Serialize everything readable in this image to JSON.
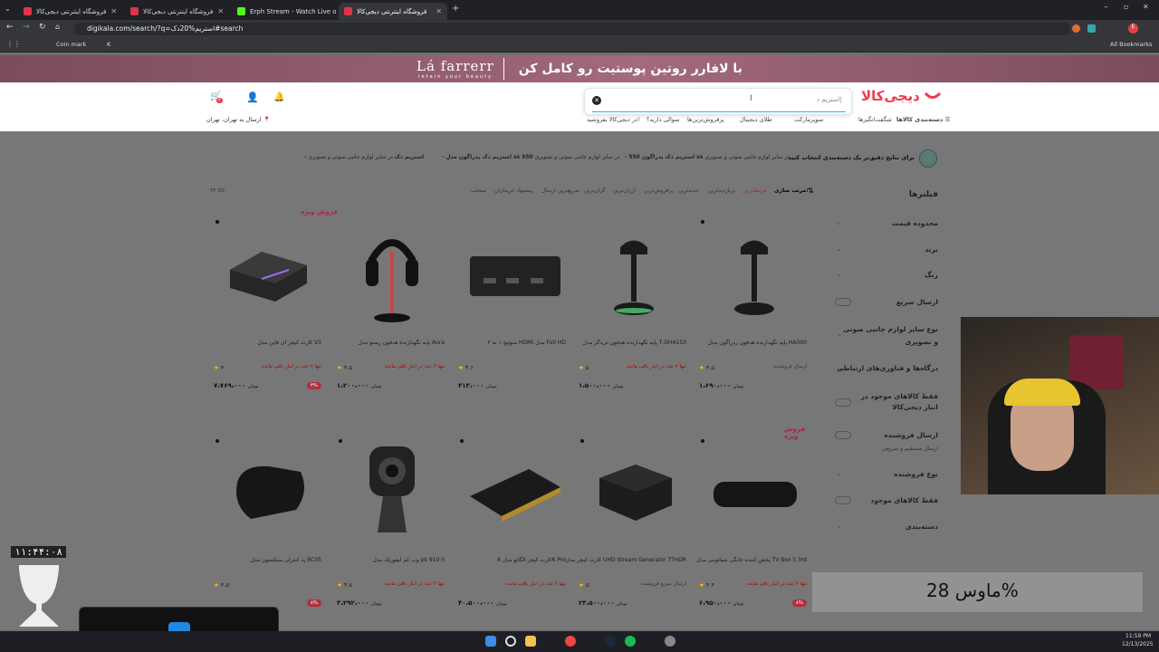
{
  "browser": {
    "tabs": [
      {
        "title": "فروشگاه اینترنتی دیجی‌کالا",
        "color": "#e0334a"
      },
      {
        "title": "فروشگاه اینترنتی دیجی‌کالا",
        "color": "#e0334a"
      },
      {
        "title": "Erph Stream - Watch Live on K",
        "color": "#53fc18"
      },
      {
        "title": "فروشگاه اینترنتی دیجی‌کالا",
        "color": "#e0334a"
      }
    ],
    "url": "digikala.com/search/?q=استریم%20دک#search",
    "bookmarks": [
      "Coin mark",
      "K"
    ],
    "all_bookmarks": "All Bookmarks"
  },
  "banner": {
    "text": "با لافارر روتین پوستیت رو کامل کن",
    "brand": "Lá farrerr",
    "tagline": "retain your beauty"
  },
  "header": {
    "logo": "دیجی‌کالا",
    "search_value": "استریم د|",
    "location": "ارسال به تهران، تهران",
    "cart_count": "۲"
  },
  "nav": {
    "categories": "دسته‌بندی کالاها",
    "items": [
      "شگفت‌انگیزها",
      "سوپرمارکت",
      "طلای دیجیتال",
      "پرفروش‌ترین‌ها",
      "سوالی دارید؟",
      "در دیجی‌کالا بفروشید!"
    ]
  },
  "suggest": {
    "lead": "برای نتایج دقیق‌تر یک دسته‌بندی انتخاب کنید",
    "chips": [
      {
        "bold": "استریم دک پدراگون 550 ss",
        "rest": "در سایر لوازم جانبی صوتی و تصویری"
      },
      {
        "bold": "استریم دک پدراگون مدل ss 550",
        "rest": "در سایر لوازم جانبی صوتی و تصویری"
      },
      {
        "bold": "استریم دک",
        "rest": "در سایر لوازم جانبی صوتی و تصویری"
      }
    ]
  },
  "sort": {
    "label": "مرتب سازی:",
    "options": [
      "مرتبط‌ترین",
      "پربازدیدترین",
      "جدیدترین",
      "پرفروش‌ترین",
      "ارزان‌ترین",
      "گران‌ترین",
      "سریع‌ترین ارسال",
      "پیشنهاد خریداران",
      "منتخب"
    ],
    "count": "۳۳ کالا"
  },
  "filters": {
    "title": "فیلترها",
    "items": [
      "محدوده قیمت",
      "برند",
      "رنگ",
      "ارسال سریع",
      "نوع سایر لوازم جانبی صوتی و تصویری",
      "درگاه‌ها و فناوری‌های ارتباطی",
      "فقط کالاهای موجود در انبار دیجی‌کالا",
      "ارسال فروشنده",
      "نوع فروشنده",
      "فقط کالاهای موجود",
      "دسته‌بندی"
    ],
    "seller_sub": "ارسال مستقیم و سریع‌تر"
  },
  "products": [
    {
      "title": "پایه نگهدارنده هدفون ردراگون مدل HA300",
      "rating": "۴.۵",
      "stock": "ارسال فروشنده",
      "price": "۱،۶۹۰،۰۰۰",
      "disc": "",
      "special": ""
    },
    {
      "title": "پایه نگهدارنده هدفون تی‌دگر مدل T-GHA153",
      "rating": "۵",
      "stock": "تنها ۲ عدد در انبار باقی مانده",
      "price": "۱،۵۰۰،۰۰۰",
      "disc": "",
      "special": ""
    },
    {
      "title": "سوئیچ ۱ به ۲ HDMI مدل Full HD",
      "rating": "۳.۶",
      "stock": "",
      "price": "۴۱۳،۰۰۰",
      "disc": "",
      "special": ""
    },
    {
      "title": "پایه نگهدارنده هدفون رسنو مدل Aura",
      "rating": "۴.۵",
      "stock": "تنها ۲ عدد در انبار باقی مانده",
      "price": "۱،۲۰۰،۰۰۰",
      "disc": "",
      "special": "فروش ویژه"
    },
    {
      "title": "کارت کپچر ای فاین مدل V3",
      "rating": "۴",
      "stock": "تنها ۲ عدد در انبار باقی مانده",
      "price": "۷،۷۶۹،۰۰۰",
      "disc": "۳%",
      "special": ""
    },
    {
      "title": "پخش کننده خانگی شیائومی مدل TV Box S 3rd",
      "rating": "۴.۴",
      "stock": "تنها ۲ عدد در انبار باقی مانده",
      "price": "۶،۹۵۰،۰۰۰",
      "disc": "۸%",
      "special": "فروش ویژه"
    },
    {
      "title": "کارت کپچر مدل UHD Stream Generator TTHDR",
      "rating": "۵",
      "stock": "ارسال سریع فروشنده",
      "price": "۲۳،۵۰۰،۰۰۰",
      "disc": "",
      "special": ""
    },
    {
      "title": "کارت کپچر الگاتو مدل 4K Pro",
      "rating": "",
      "stock": "تنها ۲ عدد در انبار باقی مانده",
      "price": "۴۰،۵۰۰،۰۰۰",
      "disc": "",
      "special": ""
    },
    {
      "title": "وب کم ایفورتک مدل pk 910 h",
      "rating": "۳.۸",
      "stock": "تنها ۲ عدد در انبار باقی مانده",
      "price": "۳،۲۹۲،۰۰۰",
      "disc": "",
      "special": ""
    },
    {
      "title": "پد کنترلی ستکسون مدل RC05",
      "rating": "۴.۵",
      "stock": "",
      "price": "",
      "disc": "۸%",
      "special": ""
    }
  ],
  "currency": "تومان",
  "overlays": {
    "clock": "۱۱:۴۴:۰۸",
    "mouse_label": "ماوس 28%"
  },
  "taskbar": {
    "time": "11:59 PM",
    "date": "12/13/2025"
  },
  "colors": {
    "accent": "#ef394e",
    "banner": "#9a6376"
  }
}
